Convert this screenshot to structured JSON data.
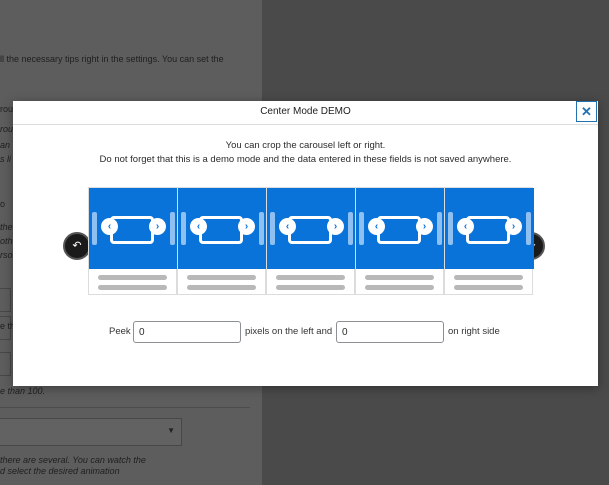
{
  "background": {
    "lines": [
      {
        "text": "ll the necessary tips right in the settings. You can set the",
        "italic": false
      },
      {
        "text": "rou",
        "italic": false
      },
      {
        "text": "rou",
        "italic": true
      },
      {
        "text": "an",
        "italic": true
      },
      {
        "text": "s li",
        "italic": true
      },
      {
        "text": "o",
        "italic": false
      },
      {
        "text": "the",
        "italic": true
      },
      {
        "text": "oth",
        "italic": true
      },
      {
        "text": "rsol",
        "italic": true
      },
      {
        "text": "e th",
        "italic": false
      },
      {
        "text": "e than 100.",
        "italic": true
      },
      {
        "text": "there are several. You can watch the",
        "italic": true
      },
      {
        "text": "d select the desired animation",
        "italic": true
      }
    ]
  },
  "modal": {
    "title": "Center Mode DEMO",
    "close_icon": "close-icon",
    "description_line1": "You can crop the carousel left or right.",
    "description_line2": "Do not forget that this is a demo mode and the data entered in these fields is not saved anywhere."
  },
  "carousel": {
    "prev_icon": "undo-arrow-icon",
    "next_icon": "redo-arrow-icon",
    "slide_count": 5,
    "slide_image_icon": "image-carousel-icon",
    "accent_color": "#0a73d9"
  },
  "peek": {
    "label_prefix": "Peek",
    "left_value": "0",
    "label_middle": "pixels on the left and",
    "right_value": "0",
    "label_suffix": "on right side"
  }
}
